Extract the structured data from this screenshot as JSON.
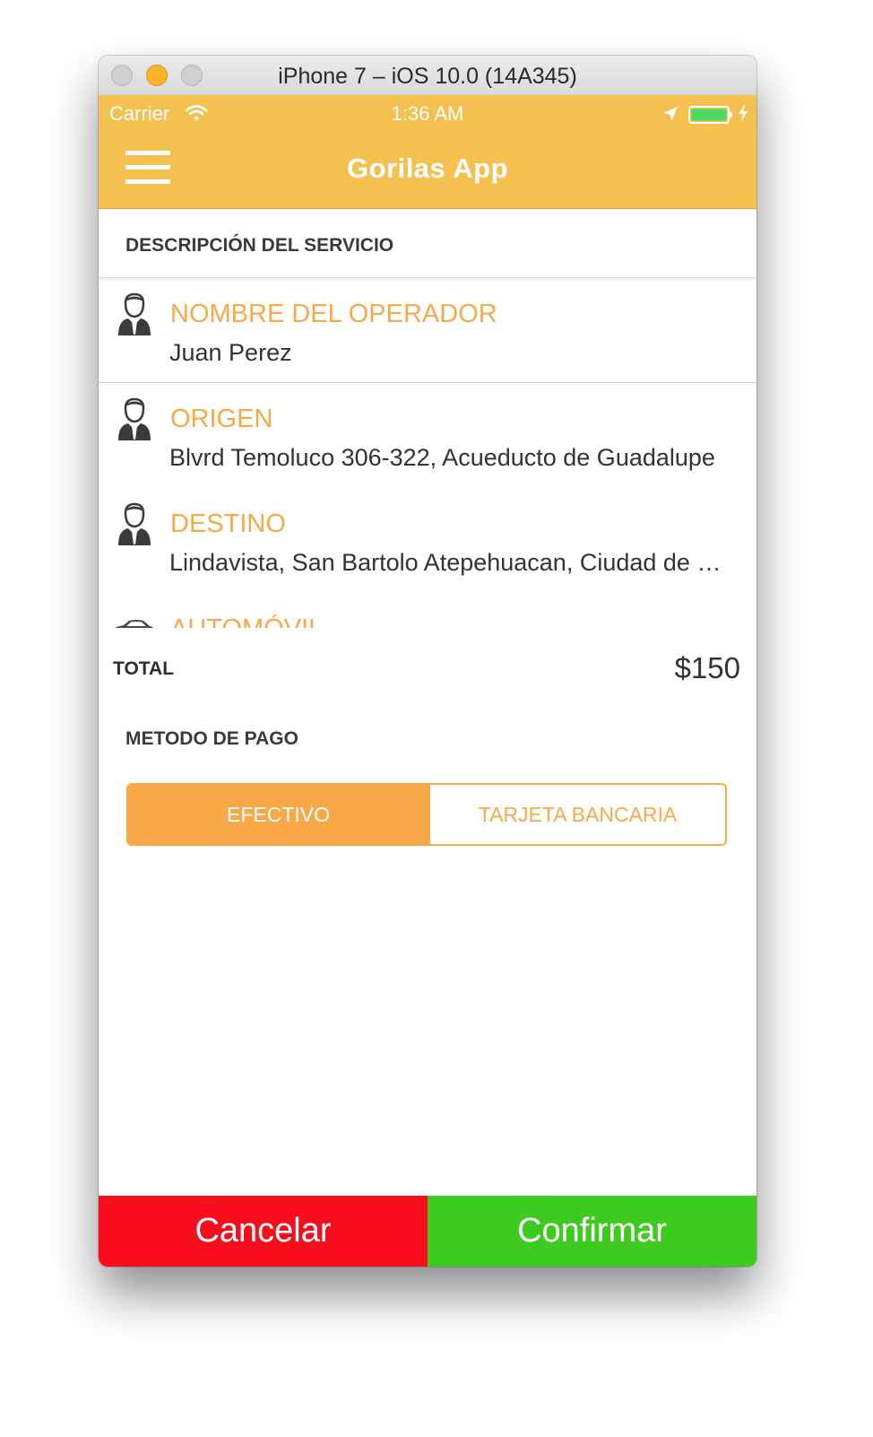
{
  "window": {
    "title": "iPhone 7 – iOS 10.0 (14A345)"
  },
  "status_bar": {
    "carrier": "Carrier",
    "time": "1:36 AM"
  },
  "nav": {
    "app_title": "Gorilas App"
  },
  "section": {
    "title": "DESCRIPCIÓN DEL SERVICIO"
  },
  "details": [
    {
      "label": "NOMBRE DEL OPERADOR",
      "value": "Juan Perez",
      "icon": "operator-icon"
    },
    {
      "label": "ORIGEN",
      "value": "Blvrd Temoluco 306-322, Acueducto de Guadalupe",
      "icon": "operator-icon"
    },
    {
      "label": "DESTINO",
      "value": "Lindavista, San Bartolo Atepehuacan, Ciudad de México",
      "icon": "operator-icon"
    },
    {
      "label": "AUTOMÓVIL",
      "value": "",
      "icon": "car-icon"
    }
  ],
  "total": {
    "label": "TOTAL",
    "value": "$150"
  },
  "payment": {
    "label": "METODO DE PAGO",
    "options": [
      "EFECTIVO",
      "TARJETA BANCARIA"
    ],
    "selected": "EFECTIVO"
  },
  "actions": {
    "cancel": "Cancelar",
    "confirm": "Confirmar"
  },
  "colors": {
    "brand_yellow": "#f4c150",
    "accent_orange": "#f8a947",
    "cancel_red": "#f90d1c",
    "confirm_green": "#3ecb1f"
  }
}
